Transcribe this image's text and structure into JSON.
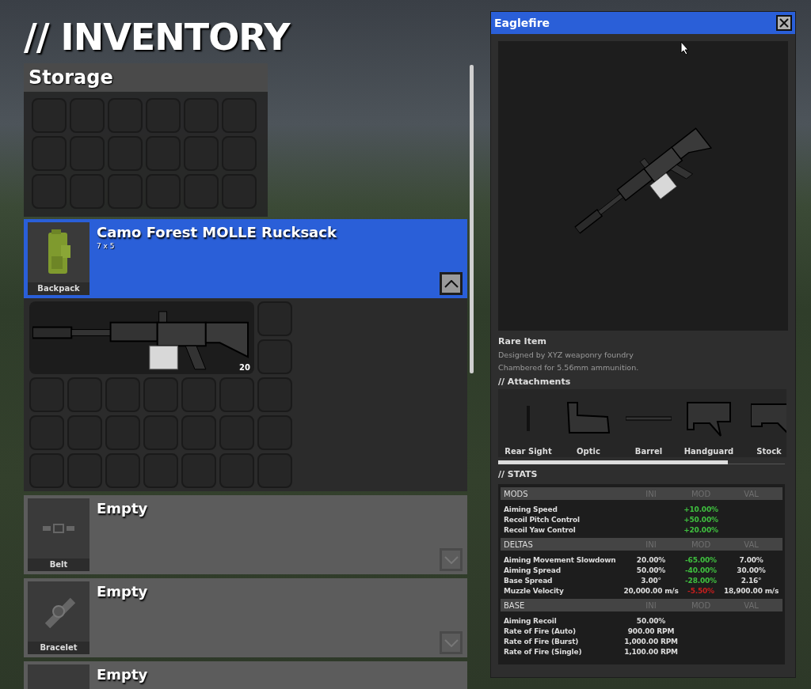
{
  "title": "// INVENTORY",
  "storage": {
    "title": "Storage"
  },
  "slots": [
    {
      "slot": "Backpack",
      "kind": "backpack",
      "name": "Camo Forest MOLLE Rucksack",
      "size": "7 x 5",
      "expanded": true,
      "contents": {
        "item_count": "20"
      }
    },
    {
      "slot": "Belt",
      "kind": "belt",
      "name": "Empty",
      "expanded": false
    },
    {
      "slot": "Bracelet",
      "kind": "bracelet",
      "name": "Empty",
      "expanded": false
    },
    {
      "name": "Empty",
      "expanded": false
    }
  ],
  "details": {
    "title": "Eaglefire",
    "rarity": "Rare Item",
    "description": [
      "Designed by XYZ weaponry foundry",
      "Chambered for 5.56mm ammunition."
    ],
    "attachments_title": "// Attachments",
    "attachments": [
      {
        "label": "Rear Sight",
        "kind": "sight"
      },
      {
        "label": "Optic",
        "kind": "optic"
      },
      {
        "label": "Barrel",
        "kind": "barrel"
      },
      {
        "label": "Handguard",
        "kind": "handguard"
      },
      {
        "label": "Stock",
        "kind": "stock"
      }
    ],
    "stats_title": "// STATS",
    "stat_sections": [
      {
        "name": "MODS",
        "columns": [
          "INI",
          "MOD",
          "VAL"
        ],
        "rows": [
          {
            "label": "Aiming Speed",
            "mod": "+10.00%",
            "kind": "good"
          },
          {
            "label": "Recoil Pitch Control",
            "mod": "+50.00%",
            "kind": "good"
          },
          {
            "label": "Recoil Yaw Control",
            "mod": "+20.00%",
            "kind": "good"
          }
        ]
      },
      {
        "name": "DELTAS",
        "columns": [
          "INI",
          "MOD",
          "VAL"
        ],
        "rows": [
          {
            "label": "Aiming Movement Slowdown",
            "ini": "20.00%",
            "mod": "-65.00%",
            "val": "7.00%",
            "kind": "good"
          },
          {
            "label": "Aiming Spread",
            "ini": "50.00%",
            "mod": "-40.00%",
            "val": "30.00%",
            "kind": "good"
          },
          {
            "label": "Base Spread",
            "ini": "3.00°",
            "mod": "-28.00%",
            "val": "2.16°",
            "kind": "good"
          },
          {
            "label": "Muzzle Velocity",
            "ini": "20,000.00 m/s",
            "mod": "-5.50%",
            "val": "18,900.00 m/s",
            "kind": "bad"
          }
        ]
      },
      {
        "name": "BASE",
        "columns": [
          "INI",
          "MOD",
          "VAL"
        ],
        "rows": [
          {
            "label": "Aiming Recoil",
            "ini": "50.00%"
          },
          {
            "label": "Rate of Fire (Auto)",
            "ini": "900.00 RPM"
          },
          {
            "label": "Rate of Fire (Burst)",
            "ini": "1,000.00 RPM"
          },
          {
            "label": "Rate of Fire (Single)",
            "ini": "1,100.00 RPM"
          }
        ]
      }
    ]
  }
}
